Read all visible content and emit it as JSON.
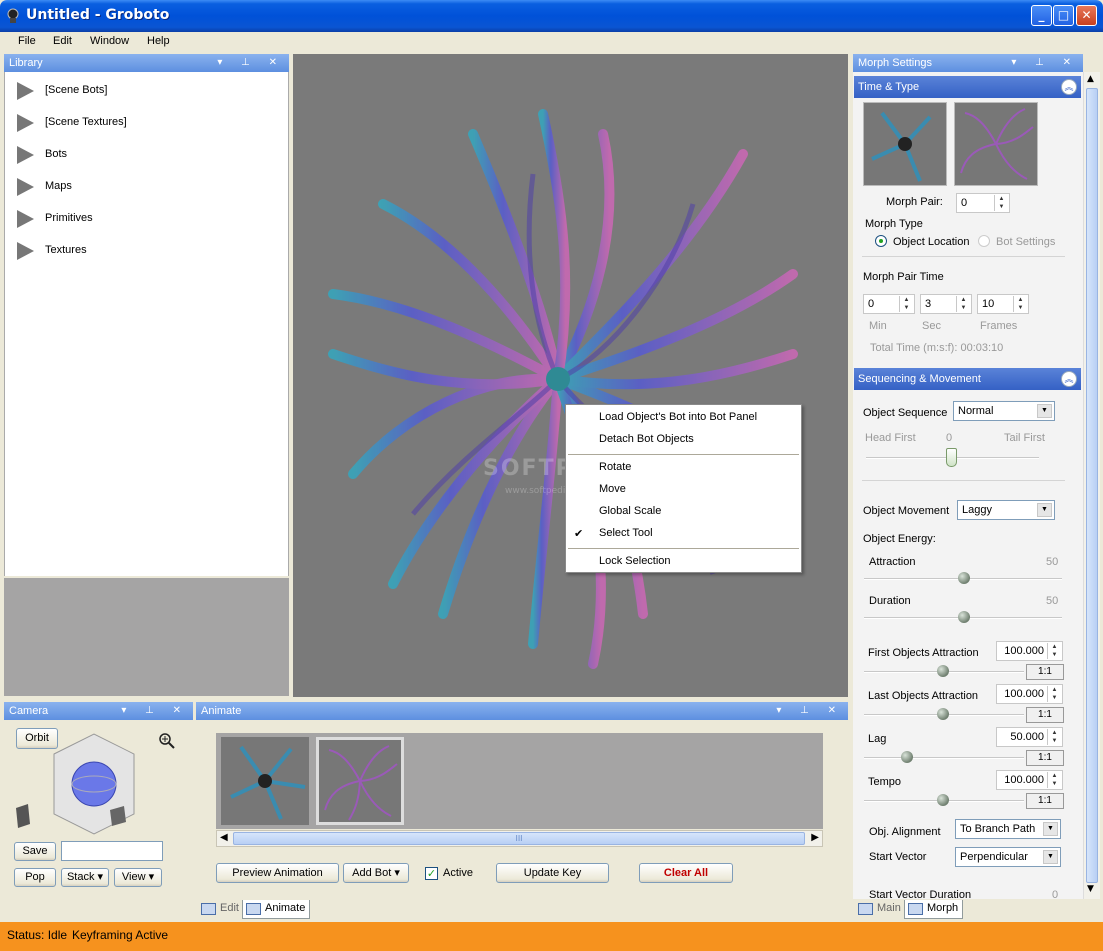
{
  "window": {
    "title": "Untitled - Groboto",
    "minimize": "_",
    "maximize": "□",
    "close": "✕"
  },
  "menu": [
    "File",
    "Edit",
    "Window",
    "Help"
  ],
  "library": {
    "title": "Library",
    "items": [
      "[Scene Bots]",
      "[Scene Textures]",
      "Bots",
      "Maps",
      "Primitives",
      "Textures"
    ]
  },
  "context_menu": {
    "items": [
      "Load Object's Bot into Bot Panel",
      "Detach Bot Objects",
      "Rotate",
      "Move",
      "Global Scale",
      "Select Tool",
      "Lock Selection"
    ],
    "checked": "Select Tool"
  },
  "viewport": {
    "watermark": "SOFTPEDIA",
    "watermark_url": "www.softpedia.com"
  },
  "camera": {
    "title": "Camera",
    "orbit": "Orbit",
    "save": "Save",
    "pop": "Pop",
    "stack": "Stack",
    "view": "View"
  },
  "animate": {
    "title": "Animate",
    "preview": "Preview Animation",
    "add_bot": "Add Bot",
    "active_label": "Active",
    "update_key": "Update Key",
    "clear_all": "Clear All",
    "scroll_grip": "III"
  },
  "left_tabs": [
    "Edit",
    "Animate"
  ],
  "right_tabs": [
    "Main",
    "Morph"
  ],
  "morph": {
    "title": "Morph Settings",
    "time_type": "Time & Type",
    "morph_pair_label": "Morph Pair:",
    "morph_pair_value": "0",
    "morph_type_label": "Morph Type",
    "opt_object_location": "Object Location",
    "opt_bot_settings": "Bot Settings",
    "morph_pair_time": "Morph Pair Time",
    "min_value": "0",
    "sec_value": "3",
    "frames_value": "10",
    "min_label": "Min",
    "sec_label": "Sec",
    "frames_label": "Frames",
    "total_time": "Total Time (m:s:f): 00:03:10",
    "seq_movement": "Sequencing & Movement",
    "object_sequence_label": "Object Sequence",
    "object_sequence_value": "Normal",
    "head_first": "Head First",
    "seq_value": "0",
    "tail_first": "Tail First",
    "object_movement_label": "Object Movement",
    "object_movement_value": "Laggy",
    "object_energy": "Object Energy:",
    "attraction_label": "Attraction",
    "attraction_value": "50",
    "duration_label": "Duration",
    "duration_value": "50",
    "first_attraction_label": "First Objects Attraction",
    "first_attraction_value": "100.000",
    "last_attraction_label": "Last Objects Attraction",
    "last_attraction_value": "100.000",
    "lag_label": "Lag",
    "lag_value": "50.000",
    "tempo_label": "Tempo",
    "tempo_value": "100.000",
    "ratio": "1:1",
    "alignment_label": "Obj. Alignment",
    "alignment_value": "To Branch Path",
    "start_vector_label": "Start Vector",
    "start_vector_value": "Perpendicular",
    "start_vector_duration_label": "Start Vector Duration",
    "start_vector_duration_value": "0"
  },
  "status": {
    "state": "Status: Idle",
    "mode": "Keyframing Active"
  }
}
